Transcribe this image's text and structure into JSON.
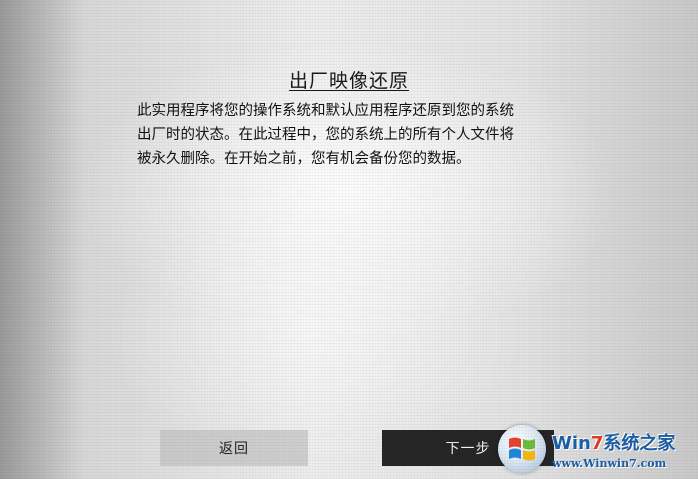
{
  "dialog": {
    "title": "出厂映像还原",
    "description_lines": [
      "此实用程序将您的操作系统和默认应用程序还原到您的系统",
      "出厂时的状态。在此过程中，您的系统上的所有个人文件将",
      "被永久删除。在开始之前，您有机会备份您的数据。"
    ],
    "back_label": "返回",
    "next_label": "下一步"
  },
  "watermark": {
    "title_prefix": "W",
    "title_seven": "7",
    "title_suffix": "系统之家",
    "title_mid": "in",
    "url": "www.Winwin7.com"
  },
  "colors": {
    "next_button_bg": "#262626",
    "watermark_blue": "#1b5fa8",
    "watermark_red": "#e03a2a"
  }
}
